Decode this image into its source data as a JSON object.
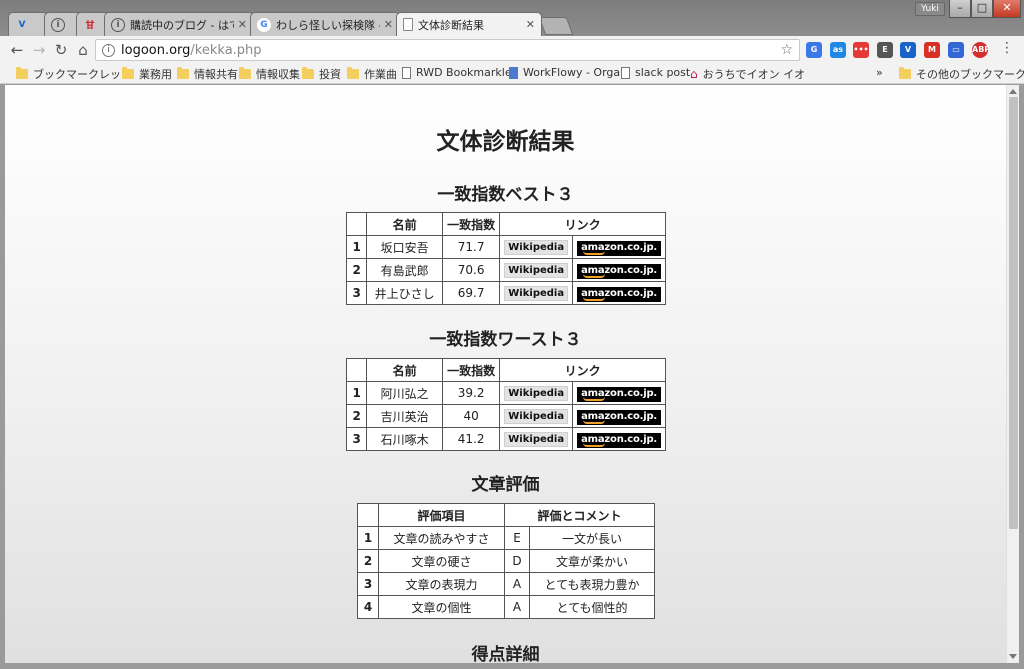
{
  "browser": {
    "tabs": [
      {
        "label": "",
        "favicon": "v-logo-icon",
        "color": "#1a63c9"
      },
      {
        "label": "",
        "favicon": "info-icon",
        "color": "#555555"
      },
      {
        "label": "",
        "favicon": "kanji-logo-icon",
        "color": "#c8141e"
      },
      {
        "label": "購読中のブログ - はてな",
        "favicon": "info-icon",
        "color": "#555555"
      },
      {
        "label": "わしら怪しい探検隊 - G",
        "favicon": "google-icon",
        "color": "#4285f4"
      },
      {
        "label": "文体診断結果",
        "favicon": "page-icon",
        "color": "#888888"
      }
    ],
    "user": "Yuki",
    "url_host": "logoon.org",
    "url_path": "/kekka.php",
    "bookmarks": [
      {
        "label": "ブックマークレット",
        "icon": "folder-icon"
      },
      {
        "label": "業務用",
        "icon": "folder-icon"
      },
      {
        "label": "情報共有",
        "icon": "folder-icon"
      },
      {
        "label": "情報収集",
        "icon": "folder-icon"
      },
      {
        "label": "投資",
        "icon": "folder-icon"
      },
      {
        "label": "作業曲",
        "icon": "folder-icon"
      },
      {
        "label": "RWD Bookmarklet",
        "icon": "page-icon"
      },
      {
        "label": "WorkFlowy - Organ",
        "icon": "workflowy-icon"
      },
      {
        "label": "slack post",
        "icon": "page-icon"
      },
      {
        "label": "おうちでイオン イオ",
        "icon": "house-icon"
      }
    ],
    "bookmarks_overflow": "»",
    "other_bookmarks": "その他のブックマーク"
  },
  "page": {
    "title": "文体診断結果",
    "best": {
      "heading": "一致指数ベスト３",
      "headers": [
        "名前",
        "一致指数",
        "リンク"
      ],
      "rows": [
        {
          "rank": "1",
          "name": "坂口安吾",
          "score": "71.7"
        },
        {
          "rank": "2",
          "name": "有島武郎",
          "score": "70.6"
        },
        {
          "rank": "3",
          "name": "井上ひさし",
          "score": "69.7"
        }
      ]
    },
    "worst": {
      "heading": "一致指数ワースト３",
      "headers": [
        "名前",
        "一致指数",
        "リンク"
      ],
      "rows": [
        {
          "rank": "1",
          "name": "阿川弘之",
          "score": "39.2"
        },
        {
          "rank": "2",
          "name": "吉川英治",
          "score": "40"
        },
        {
          "rank": "3",
          "name": "石川啄木",
          "score": "41.2"
        }
      ]
    },
    "links": {
      "wikipedia": "Wikipedia",
      "amazon": "amazon.co.jp."
    },
    "evaluation": {
      "heading": "文章評価",
      "headers": [
        "評価項目",
        "評価とコメント"
      ],
      "rows": [
        {
          "rank": "1",
          "item": "文章の読みやすさ",
          "grade": "E",
          "comment": "一文が長い"
        },
        {
          "rank": "2",
          "item": "文章の硬さ",
          "grade": "D",
          "comment": "文章が柔かい"
        },
        {
          "rank": "3",
          "item": "文章の表現力",
          "grade": "A",
          "comment": "とても表現力豊か"
        },
        {
          "rank": "4",
          "item": "文章の個性",
          "grade": "A",
          "comment": "とても個性的"
        }
      ]
    },
    "score_detail_heading": "得点詳細"
  }
}
